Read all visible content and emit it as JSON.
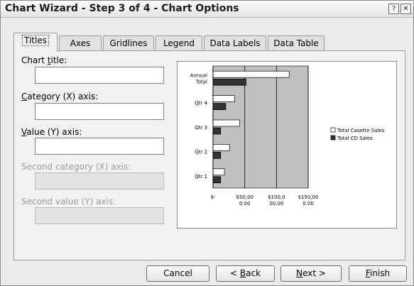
{
  "window": {
    "title": "Chart Wizard - Step 3 of 4 - Chart Options",
    "help_glyph": "?",
    "close_glyph": "✕"
  },
  "tabs": [
    {
      "label": "Titles",
      "active": true
    },
    {
      "label": "Axes",
      "active": false
    },
    {
      "label": "Gridlines",
      "active": false
    },
    {
      "label": "Legend",
      "active": false
    },
    {
      "label": "Data Labels",
      "active": false
    },
    {
      "label": "Data Table",
      "active": false
    }
  ],
  "form": {
    "chart_title": {
      "label_pre": "Chart ",
      "label_key": "t",
      "label_post": "itle:",
      "value": ""
    },
    "category_axis": {
      "label_pre": "",
      "label_key": "C",
      "label_post": "ategory (X) axis:",
      "value": ""
    },
    "value_axis": {
      "label_pre": "",
      "label_key": "V",
      "label_post": "alue (Y) axis:",
      "value": ""
    },
    "second_category_axis": {
      "label": "Second category (X) axis:",
      "value": "",
      "disabled": true
    },
    "second_value_axis": {
      "label": "Second value (Y) axis:",
      "value": "",
      "disabled": true
    }
  },
  "chart_data": {
    "type": "bar",
    "orientation": "horizontal",
    "categories": [
      "Qtr 1",
      "Qtr 2",
      "Qtr 3",
      "Qtr 4",
      "Annual Total"
    ],
    "category_labels": [
      [
        "Qtr 1"
      ],
      [
        "Qtr 2"
      ],
      [
        "Qtr 3"
      ],
      [
        "Qtr 4"
      ],
      [
        "Annual",
        "Total"
      ]
    ],
    "series": [
      {
        "name": "Total Casette Sales",
        "color": "#ffffff",
        "values": [
          18000,
          26000,
          42000,
          34000,
          120000
        ]
      },
      {
        "name": "Total CD Sales",
        "color": "#333333",
        "values": [
          12000,
          12000,
          12000,
          20000,
          52000
        ]
      }
    ],
    "xlim": [
      0,
      150000
    ],
    "x_ticks": [
      {
        "value": 0,
        "lines": [
          "$-"
        ]
      },
      {
        "value": 50000,
        "lines": [
          "$50,00",
          "0.00"
        ]
      },
      {
        "value": 100000,
        "lines": [
          "$100,0",
          "00.00"
        ]
      },
      {
        "value": 150000,
        "lines": [
          "$150,00",
          "0.00"
        ]
      }
    ],
    "plot_background": "#c0c0c0",
    "gridlines": true,
    "legend_position": "right",
    "title": "",
    "xlabel": "",
    "ylabel": ""
  },
  "buttons": {
    "cancel": "Cancel",
    "back_pre": "< ",
    "back_key": "B",
    "back_post": "ack",
    "next_key": "N",
    "next_post": "ext >",
    "finish_key": "F",
    "finish_post": "inish"
  }
}
